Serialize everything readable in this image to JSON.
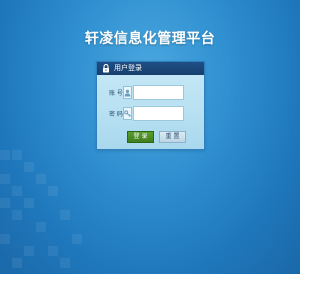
{
  "page": {
    "title": "轩凌信息化管理平台"
  },
  "login_panel": {
    "title": "用户登录",
    "icon": "lock-icon",
    "fields": [
      {
        "label": "账 号",
        "icon": "user-icon",
        "value": "",
        "placeholder": ""
      },
      {
        "label": "密 码",
        "icon": "key-icon",
        "value": "",
        "placeholder": ""
      }
    ],
    "login_label": "登 录",
    "reset_label": "重 置"
  },
  "colors": {
    "background": "#2f8fd0",
    "panel_header": "#1f4f86",
    "panel_body": "#b8e1f2",
    "login_button": "#4a8b26",
    "reset_button": "#c8dfeb"
  }
}
